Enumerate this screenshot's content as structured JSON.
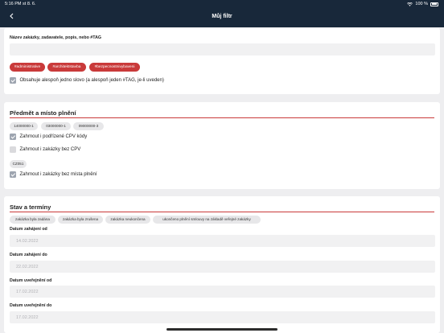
{
  "status_bar": {
    "time": "5:16 PM",
    "date": "st 8. 6.",
    "battery": "100 %"
  },
  "header": {
    "title": "Můj filtr"
  },
  "search": {
    "label": "Název zakázky, zadavatele, popis, nebo #TAG",
    "value": ""
  },
  "tags": [
    "#administrative",
    "#architektstavba",
    "#bezpecnostnivybaveni"
  ],
  "contains_any_word": {
    "label": "Obsahuje alespoň jedno slovo (a alespoň jeden #TAG, je-li uveden)",
    "checked": true
  },
  "subject_section": {
    "title": "Předmět a místo plnění",
    "cpv_codes": [
      "14000000-1",
      "03000000-1",
      "09000000-3"
    ],
    "include_sub_cpv": {
      "label": "Zahrnout i podřízené CPV kódy",
      "checked": true
    },
    "include_no_cpv": {
      "label": "Zahrnout i zakázky bez CPV",
      "checked": false
    },
    "regions": [
      "CZ051"
    ],
    "include_no_place": {
      "label": "Zahrnout i zakázky bez místa plnění",
      "checked": true
    }
  },
  "status_section": {
    "title": "Stav a termíny",
    "states": [
      "zakázka byla zadána",
      "zakázka byla zrušena",
      "zakázka neukončena",
      "ukončeno plnění smlouvy na základě veřejné zakázky"
    ],
    "dates": [
      {
        "label": "Datum zahájení od",
        "value": "14.02.2022"
      },
      {
        "label": "Datum zahájení do",
        "value": "22.02.2022"
      },
      {
        "label": "Datum uveřejnění od",
        "value": "17.02.2022"
      },
      {
        "label": "Datum uveřejnění do",
        "value": "17.02.2022"
      }
    ]
  },
  "icons": {
    "back": "chevron-left-icon",
    "wifi": "wifi-icon",
    "battery": "battery-icon",
    "checkbox": "check-icon"
  },
  "colors": {
    "header_bg": "#18283a",
    "accent": "#c93a3a",
    "page_bg": "#eeeef0",
    "checkbox_on": "#9ea5b0"
  }
}
